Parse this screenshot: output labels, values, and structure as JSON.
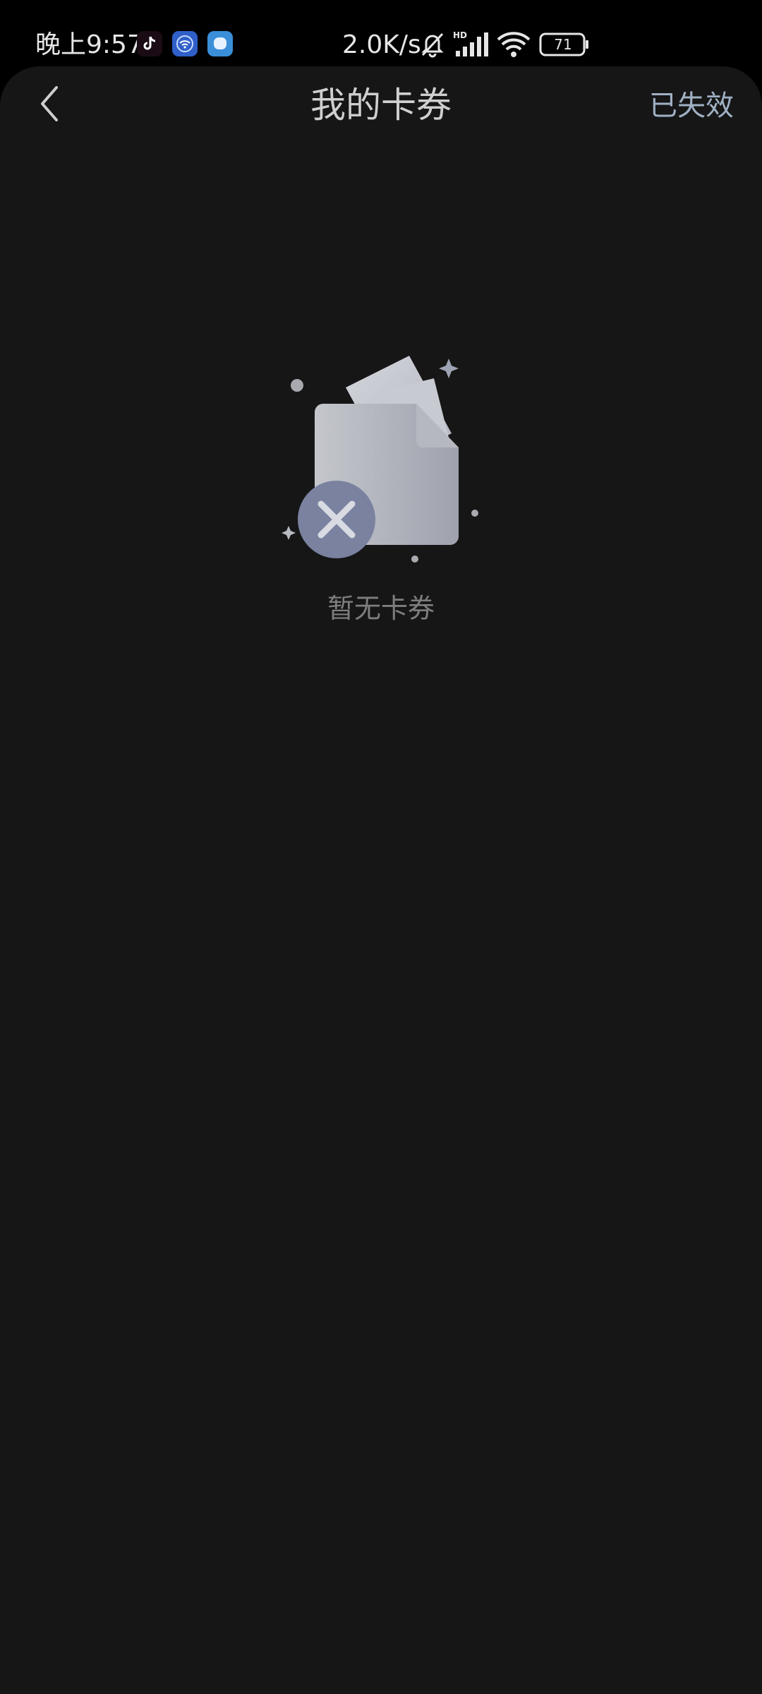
{
  "status_bar": {
    "time": "晚上9:57",
    "net_speed": "2.0K/s",
    "battery_level": "71",
    "apps": [
      {
        "icon": "tiktok-icon",
        "color": "#1a0b14"
      },
      {
        "icon": "wifi-app-icon",
        "color": "#2f5fc8"
      },
      {
        "icon": "chat-bubble-app-icon",
        "color": "#3a8fd8"
      }
    ],
    "indicators": [
      "mute-bell-icon",
      "hd-signal-icon",
      "wifi-icon",
      "battery-icon"
    ]
  },
  "header": {
    "title": "我的卡券",
    "back_icon": "chevron-left-icon",
    "action_label": "已失效"
  },
  "empty_state": {
    "illustration": "empty-cards-illustration",
    "message": "暂无卡券"
  },
  "colors": {
    "background": "#161616",
    "accent_link": "#9fb0c4",
    "x_badge": "#7a82a0"
  }
}
